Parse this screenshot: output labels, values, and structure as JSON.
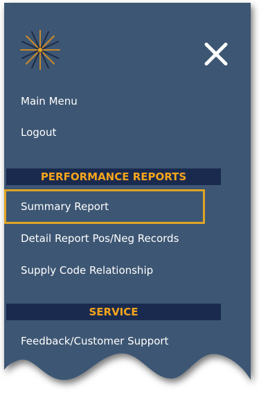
{
  "menu": {
    "links": {
      "main_menu": "Main Menu",
      "logout": "Logout"
    },
    "sections": [
      {
        "title": "PERFORMANCE REPORTS",
        "items": [
          "Summary Report",
          "Detail Report Pos/Neg Records",
          "Supply Code Relationship"
        ]
      },
      {
        "title": "SERVICE",
        "items": [
          "Feedback/Customer Support"
        ]
      }
    ],
    "highlighted_item": "Summary Report",
    "icons": {
      "logo": "starburst-logo-icon",
      "close": "close-icon"
    }
  },
  "colors": {
    "panel": "#3d5773",
    "section_header_bg": "#1a2a4f",
    "section_header_text": "#f5a51c",
    "highlight_border": "#e0a526",
    "link_text": "#ffffff"
  }
}
